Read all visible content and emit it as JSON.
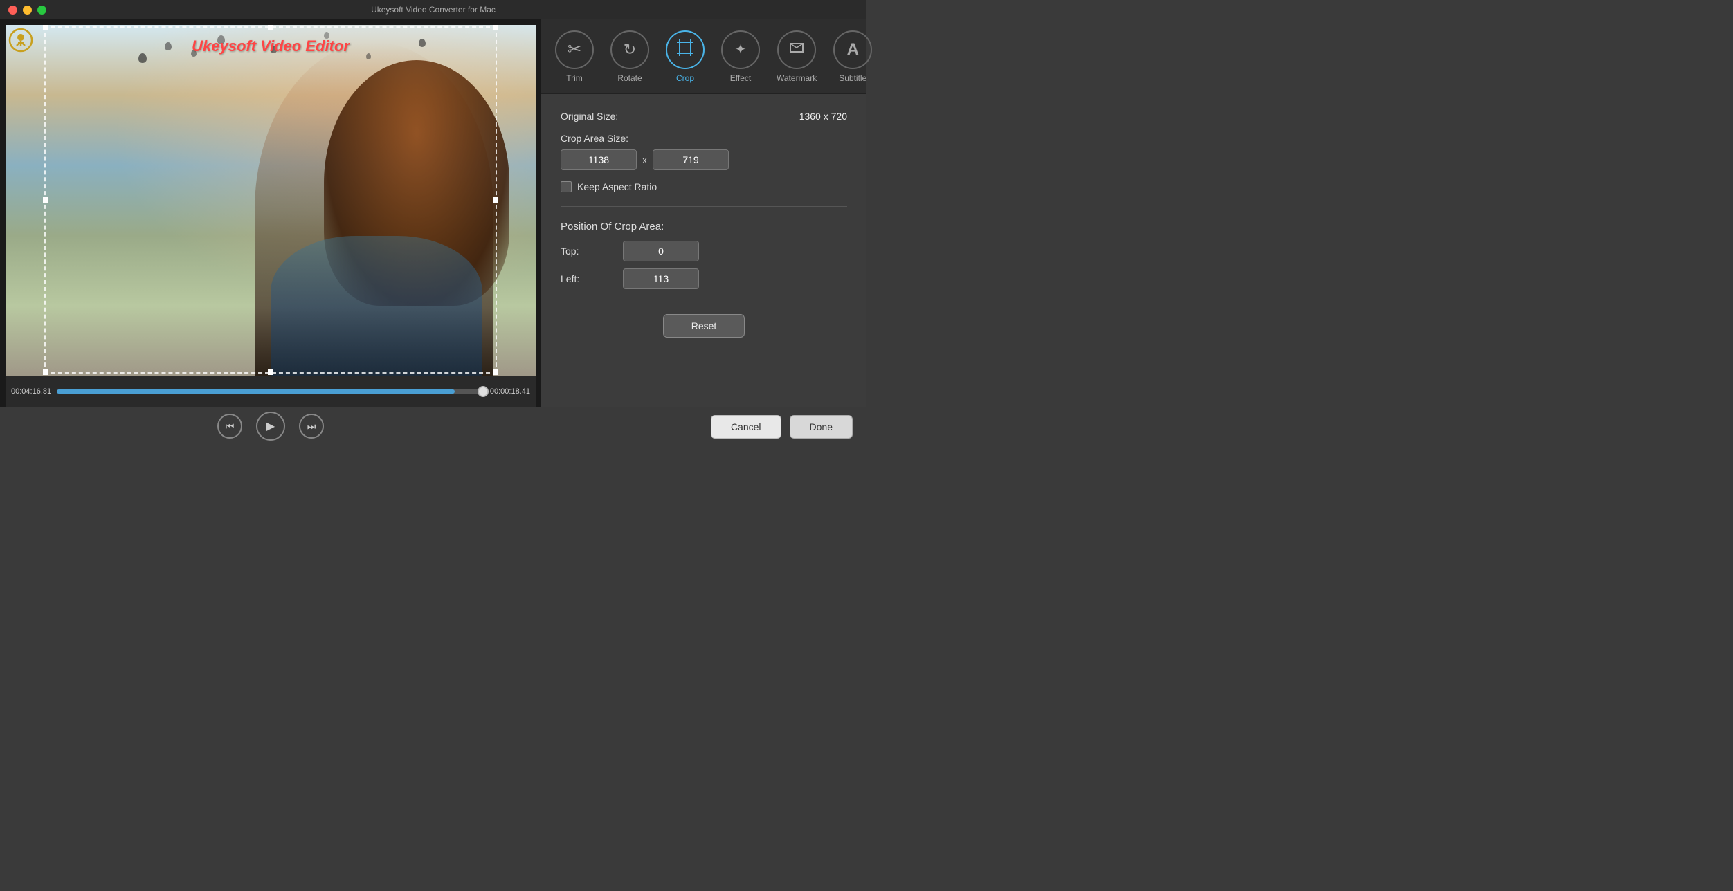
{
  "window": {
    "title": "Ukeysoft Video Converter for Mac"
  },
  "titlebar": {
    "close": "close",
    "minimize": "minimize",
    "maximize": "maximize"
  },
  "video": {
    "overlay_title": "Ukeysoft Video Editor",
    "time_left": "00:04:16.81",
    "time_right": "00:00:18.41",
    "progress_percent": 93
  },
  "controls": {
    "prev_label": "⏮",
    "play_label": "▶",
    "next_label": "⏭"
  },
  "toolbar": {
    "items": [
      {
        "id": "trim",
        "label": "Trim",
        "icon": "✂"
      },
      {
        "id": "rotate",
        "label": "Rotate",
        "icon": "↻"
      },
      {
        "id": "crop",
        "label": "Crop",
        "icon": "⊡",
        "active": true
      },
      {
        "id": "effect",
        "label": "Effect",
        "icon": "✦"
      },
      {
        "id": "watermark",
        "label": "Watermark",
        "icon": "T"
      },
      {
        "id": "subtitle",
        "label": "Subtitle",
        "icon": "A"
      }
    ]
  },
  "crop_settings": {
    "original_size_label": "Original Size:",
    "original_size_value": "1360 x 720",
    "crop_area_label": "Crop Area Size:",
    "crop_width": "1138",
    "crop_height": "719",
    "keep_aspect_ratio": "Keep Aspect Ratio",
    "position_label": "Position Of Crop Area:",
    "top_label": "Top:",
    "top_value": "0",
    "left_label": "Left:",
    "left_value": "113",
    "reset_label": "Reset"
  },
  "footer": {
    "cancel_label": "Cancel",
    "done_label": "Done"
  }
}
